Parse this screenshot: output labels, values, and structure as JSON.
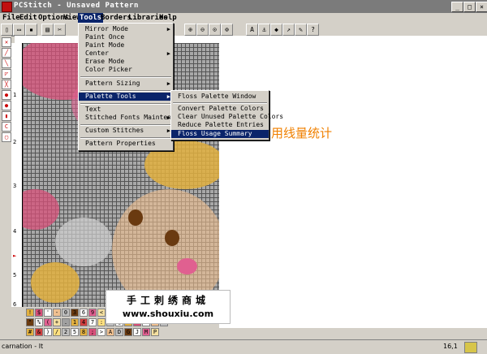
{
  "window": {
    "title": "PCStitch - Unsaved Pattern",
    "min": "_",
    "max": "□",
    "close": "×"
  },
  "menubar": [
    {
      "label": "File",
      "active": false
    },
    {
      "label": "Edit",
      "active": false
    },
    {
      "label": "Options",
      "active": false
    },
    {
      "label": "View",
      "active": false
    },
    {
      "label": "Tools",
      "active": true
    },
    {
      "label": "Borders",
      "active": false
    },
    {
      "label": "Libraries",
      "active": false
    },
    {
      "label": "Help",
      "active": false
    }
  ],
  "tools_menu": {
    "items": [
      {
        "label": "Mirror Mode",
        "submenu": true
      },
      {
        "label": "Paint Once",
        "submenu": false
      },
      {
        "label": "Paint Mode",
        "submenu": false
      },
      {
        "label": "Center",
        "submenu": true
      },
      {
        "label": "Erase Mode",
        "submenu": false
      },
      {
        "label": "Color Picker",
        "submenu": false
      },
      {
        "label": "Pattern Sizing",
        "submenu": true
      },
      {
        "label": "Palette Tools",
        "submenu": true,
        "highlight": true
      },
      {
        "label": "Text",
        "submenu": false
      },
      {
        "label": "Stitched Fonts Maintenance",
        "submenu": true
      },
      {
        "label": "Custom Stitches",
        "submenu": true
      },
      {
        "label": "Pattern Properties",
        "submenu": false
      }
    ]
  },
  "palette_submenu": {
    "items": [
      {
        "label": "Floss Palette Window",
        "highlight": false
      },
      {
        "label": "Convert Palette Colors",
        "highlight": false
      },
      {
        "label": "Clear Unused Palette Colors",
        "highlight": false
      },
      {
        "label": "Reduce Palette Entries",
        "highlight": false
      },
      {
        "label": "Floss Usage Summary",
        "highlight": true
      }
    ]
  },
  "annotation": "用线量统计",
  "watermark": {
    "line1": "手工刺绣商城",
    "line2": "www.shouxiu.com"
  },
  "ruler_left": [
    "1",
    "2",
    "3",
    "4",
    "5",
    "6"
  ],
  "palette_rows": [
    [
      "!",
      "$",
      "'",
      "-",
      "0",
      "3",
      "6",
      "9",
      "<",
      "?",
      "B",
      "E",
      "H",
      "K",
      "N"
    ],
    [
      "\"",
      "%",
      "(",
      "+",
      ".",
      "1",
      "4",
      "7",
      ":",
      "=",
      "@",
      "C",
      "F",
      "I",
      "L",
      "O"
    ],
    [
      "#",
      "&",
      ")",
      "/",
      "2",
      "5",
      "8",
      ";",
      ">",
      "A",
      "D",
      "G",
      "J",
      "M",
      "P"
    ]
  ],
  "status": {
    "left": "carnation - lt",
    "right": "16,1"
  },
  "colors": {
    "menu_highlight": "#0a246a",
    "annotation": "#f08000",
    "pink": "#d8507a",
    "gold": "#e2b040"
  }
}
